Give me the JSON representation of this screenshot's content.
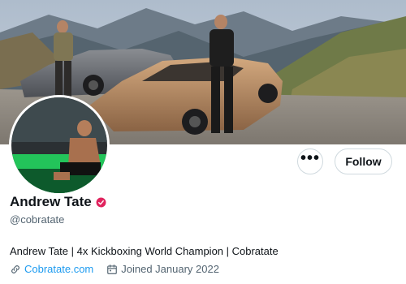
{
  "profile": {
    "name": "Andrew Tate",
    "handle": "@cobratate",
    "bio": "Andrew Tate | 4x Kickboxing World Champion | Cobratate",
    "website": "Cobratate.com",
    "joined": "Joined January 2022",
    "verified_badge_color": "#e0245e"
  },
  "actions": {
    "more_glyph": "•••",
    "follow_label": "Follow"
  },
  "colors": {
    "secondary_text": "#536471",
    "link": "#1d9bf0",
    "border": "#cfd9de"
  },
  "icons": [
    "more-icon",
    "verified-badge-icon",
    "link-icon",
    "calendar-icon"
  ]
}
